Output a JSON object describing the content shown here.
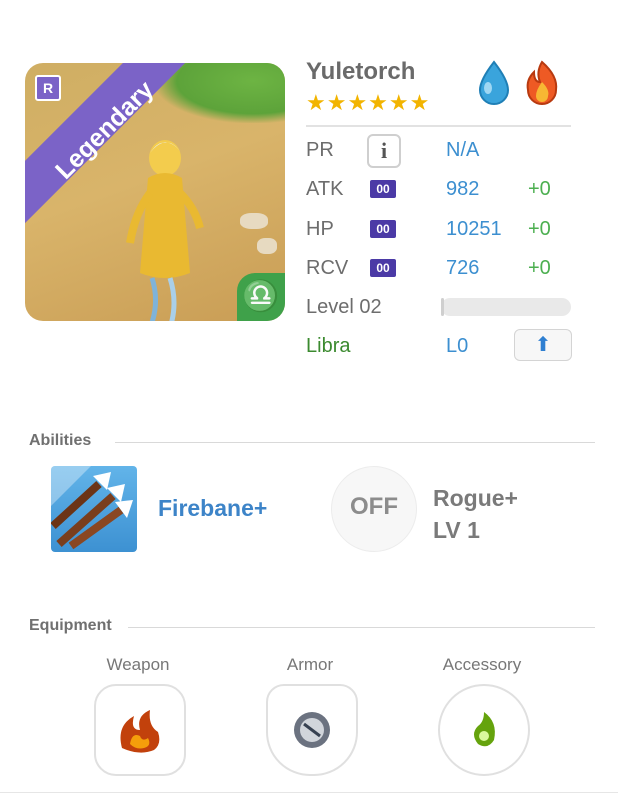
{
  "hero": {
    "name": "Yuletorch",
    "rarity": "Legendary",
    "rarity_badge": "R",
    "stars": "★★★★★★",
    "star_count": 6,
    "elements": [
      "water-drop-icon",
      "fire-icon"
    ]
  },
  "stats": {
    "pr_label": "PR",
    "pr_value": "N/A",
    "atk_label": "ATK",
    "atk_badge": "00",
    "atk_value": "982",
    "atk_bonus": "+0",
    "hp_label": "HP",
    "hp_badge": "00",
    "hp_value": "10251",
    "hp_bonus": "+0",
    "rcv_label": "RCV",
    "rcv_badge": "00",
    "rcv_value": "726",
    "rcv_bonus": "+0",
    "level_label": "Level 02",
    "level_progress": 0.02,
    "zodiac_label": "Libra",
    "zodiac_level": "L0"
  },
  "abilities": {
    "title": "Abilities",
    "primary_name": "Firebane+",
    "secondary_status": "OFF",
    "secondary_name_line1": "Rogue+",
    "secondary_name_line2": "LV 1"
  },
  "equipment": {
    "title": "Equipment",
    "weapon_label": "Weapon",
    "armor_label": "Armor",
    "accessory_label": "Accessory"
  },
  "colors": {
    "legendary_purple": "#7b63c7",
    "stat_blue": "#3c8fd0",
    "bonus_green": "#4caf50",
    "zodiac_green": "#3fa14a",
    "star_gold": "#f2b400"
  }
}
